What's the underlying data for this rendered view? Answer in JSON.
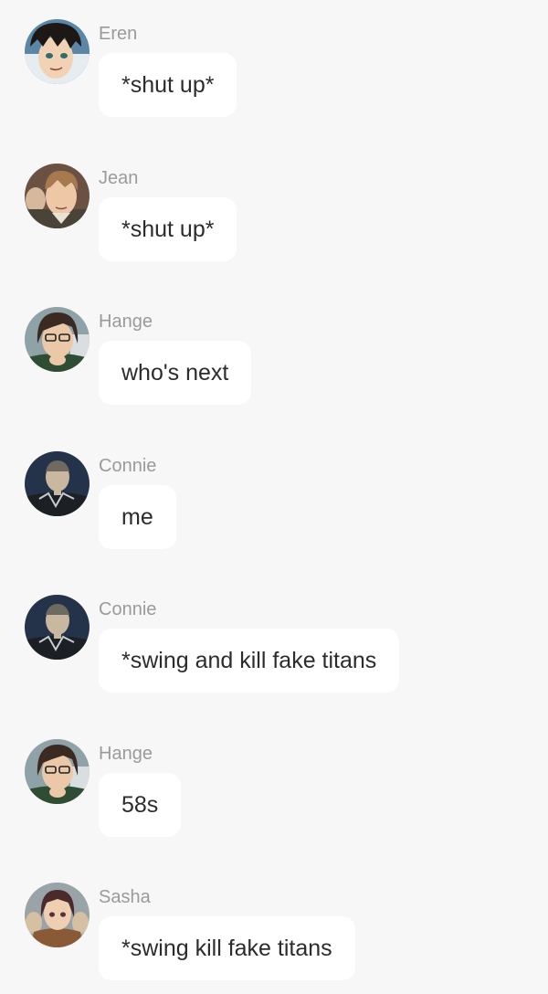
{
  "messages": [
    {
      "sender": "Eren",
      "avatar_icon": "eren-avatar-icon",
      "text": "*shut up*"
    },
    {
      "sender": "Jean",
      "avatar_icon": "jean-avatar-icon",
      "text": "*shut up*"
    },
    {
      "sender": "Hange",
      "avatar_icon": "hange-avatar-icon",
      "text": "who's next"
    },
    {
      "sender": "Connie",
      "avatar_icon": "connie-avatar-icon",
      "text": "me"
    },
    {
      "sender": "Connie",
      "avatar_icon": "connie-avatar-icon",
      "text": "*swing and kill fake titans"
    },
    {
      "sender": "Hange",
      "avatar_icon": "hange-avatar-icon",
      "text": "58s"
    },
    {
      "sender": "Sasha",
      "avatar_icon": "sasha-avatar-icon",
      "text": "*swing kill fake titans"
    }
  ]
}
